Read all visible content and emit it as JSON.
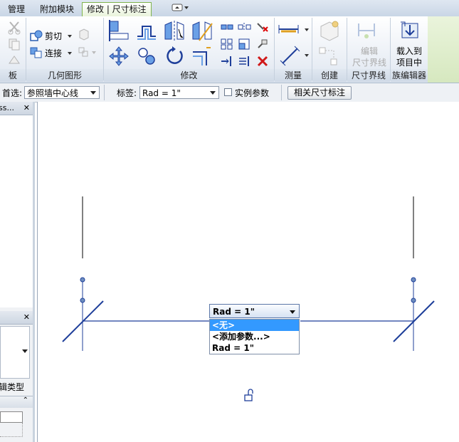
{
  "tabs": [
    {
      "label": "管理",
      "active": false
    },
    {
      "label": "附加模块",
      "active": false
    },
    {
      "label": "修改 | 尺寸标注",
      "active": true
    }
  ],
  "ribbon": {
    "panels": {
      "clipboard_partial": "板",
      "geometry": "几何图形",
      "modify": "修改",
      "measure": "测量",
      "create": "创建",
      "witness": "尺寸界线",
      "family_editor": "族编辑器"
    },
    "geometry_cut": "剪切",
    "geometry_join": "连接",
    "witness_edit_line1": "编辑",
    "witness_edit_line2": "尺寸界线",
    "load_line1": "载入到",
    "load_line2": "项目中"
  },
  "optionbar": {
    "prefer_label": "首选:",
    "prefer_value": "参照墙中心线",
    "label_label": "标签:",
    "label_value": "Rad = 1\"",
    "instance_param": "实例参数",
    "instance_checked": false,
    "related_dims_button": "相关尺寸标注"
  },
  "leftpane": {
    "top_header": "ss...",
    "mid_header": "",
    "edit_type": "辑类型"
  },
  "dropdown": {
    "value": "Rad = 1\"",
    "items": [
      {
        "label": "<无>",
        "selected": true
      },
      {
        "label": "<添加参数...>",
        "selected": false
      },
      {
        "label": "Rad = 1\"",
        "selected": false
      }
    ]
  },
  "colors": {
    "dimension_line": "#1f3f9a",
    "selection_blue": "#3399ff",
    "ribbon_active_tab": "#7fb34d"
  }
}
